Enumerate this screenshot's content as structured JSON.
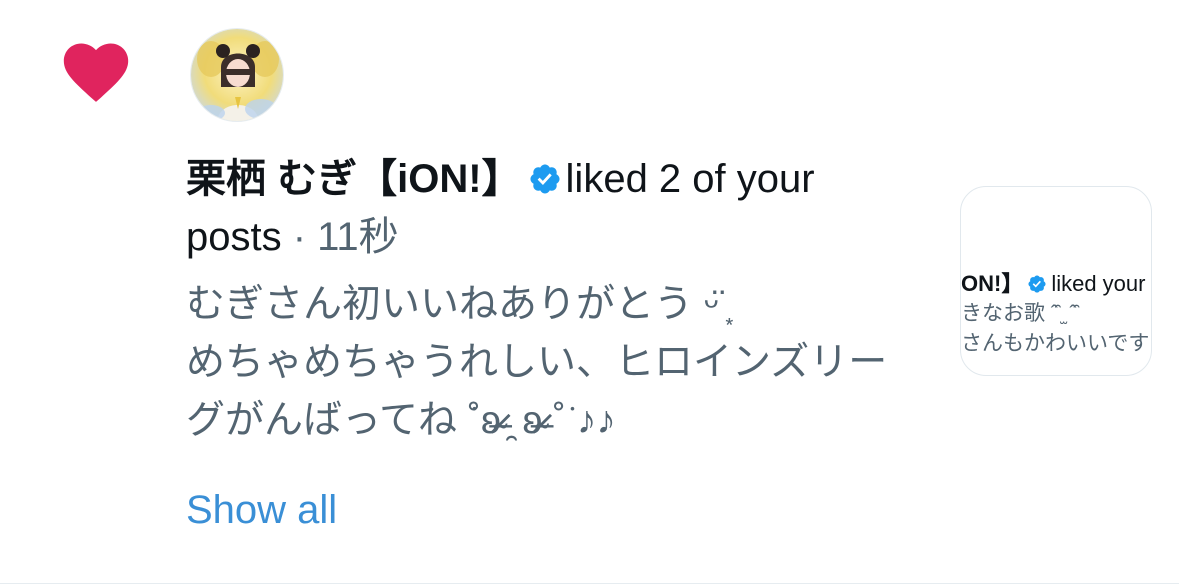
{
  "notification": {
    "heart_color": "#e0245e",
    "user_name": "栗栖 むぎ【iON!】",
    "action_text": "liked 2 of your posts",
    "separator": " · ",
    "time": "11秒",
    "tweet_text": "むぎさん初いいねありがとう ᵕ̈ ͙\nめちゃめちゃうれしい、ヒロインズリーグがんばってね ͘˚ʚ̴̶̷̷ ̯ ʚ̴̶̷̷ ˚͘ ♪♪",
    "show_all_label": "Show all",
    "verified_color": "#1d9bf0"
  },
  "preview": {
    "line1_name": "ON!】",
    "line1_action": "liked your",
    "line2": "きなお歌 ˆ̑ ̫ ˆ̑",
    "line3": "さんもかわいいです"
  }
}
